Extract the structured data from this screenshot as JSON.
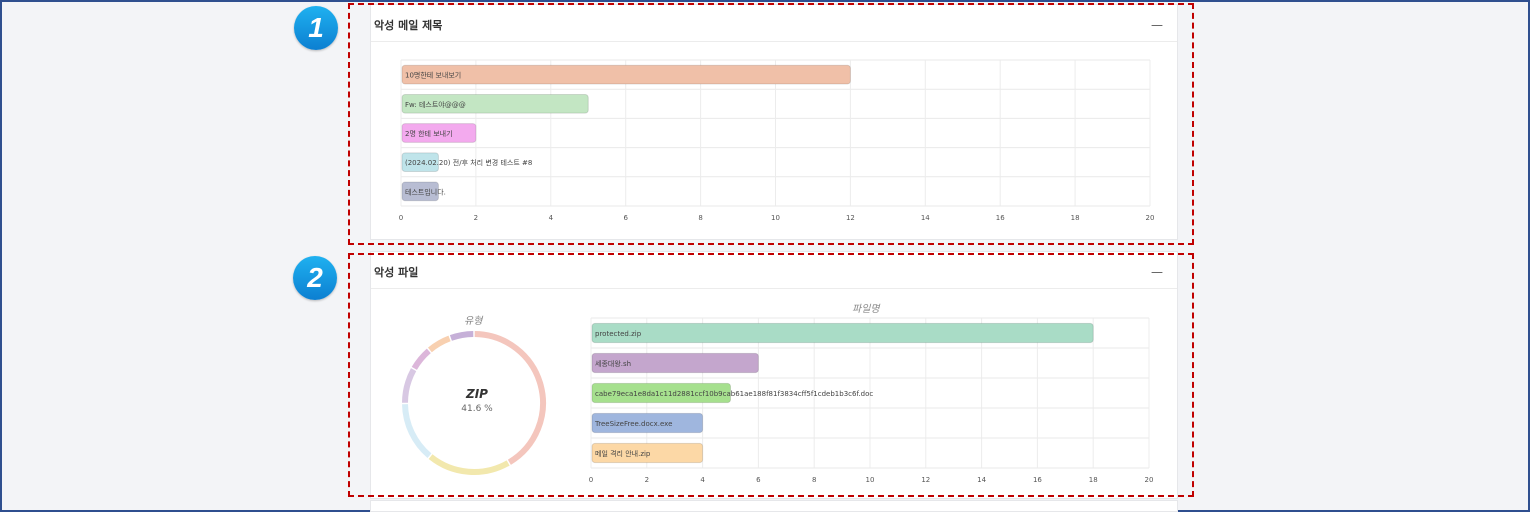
{
  "panel1": {
    "title": "악성 메일 제목",
    "collapse_icon": "minus-icon",
    "badge": "1"
  },
  "panel2": {
    "title": "악성 파일",
    "collapse_icon": "minus-icon",
    "badge": "2",
    "donut_title": "유형",
    "donut_center_label": "ZIP",
    "donut_center_value": "41.6 %",
    "bar_title": "파일명"
  },
  "chart_data": [
    {
      "type": "bar",
      "orientation": "horizontal",
      "title": "",
      "categories": [
        "10명한테 보내보기",
        "Fw: 테스트야@@@",
        "2명 한테 보내기",
        "(2024.02.20) 전/후 처리 변경 테스트 #8",
        "테스트입니다."
      ],
      "values": [
        12,
        5,
        2,
        1,
        1
      ],
      "colors": [
        "#f0c0a8",
        "#c3e6c3",
        "#f3aaee",
        "#bfe4ea",
        "#b8bdd3"
      ],
      "xlim": [
        0,
        20
      ],
      "xticks": [
        0,
        2,
        4,
        6,
        8,
        10,
        12,
        14,
        16,
        18,
        20
      ],
      "grid": true
    },
    {
      "type": "pie",
      "title": "유형",
      "donut": true,
      "center_label": "ZIP",
      "center_value": "41.6 %",
      "values": [
        41.6,
        19.4,
        13.9,
        8.3,
        5.6,
        5.6,
        5.6
      ],
      "colors": [
        "#f4c6bd",
        "#f2e8ad",
        "#d7ecf6",
        "#d8c8e3",
        "#dcb6da",
        "#f8d0b0",
        "#c6b0d8"
      ]
    },
    {
      "type": "bar",
      "orientation": "horizontal",
      "title": "파일명",
      "categories": [
        "protected.zip",
        "세종대왕.sh",
        "cabe79eca1e8da1c11d2881ccf10b9cab61ae188f81f3834cff5f1cdeb1b3c6f.doc",
        "TreeSizeFree.docx.exe",
        "메일 격리 안내.zip"
      ],
      "values": [
        18,
        6,
        5,
        4,
        4
      ],
      "colors": [
        "#a9dcc6",
        "#c4a6cd",
        "#a6e08e",
        "#9fb6de",
        "#fcd8a6"
      ],
      "xlim": [
        0,
        20
      ],
      "xticks": [
        0,
        2,
        4,
        6,
        8,
        10,
        12,
        14,
        16,
        18,
        20
      ],
      "grid": true
    }
  ]
}
